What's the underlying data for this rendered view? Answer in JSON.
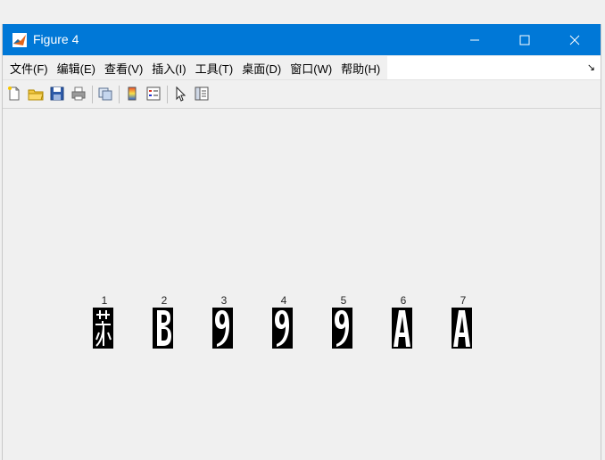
{
  "window": {
    "title": "Figure 4",
    "minimize_glyph": "—",
    "maximize_glyph": "☐",
    "close_glyph": "✕"
  },
  "menu": {
    "items": [
      {
        "label": "文件(F)"
      },
      {
        "label": "编辑(E)"
      },
      {
        "label": "查看(V)"
      },
      {
        "label": "插入(I)"
      },
      {
        "label": "工具(T)"
      },
      {
        "label": "桌面(D)"
      },
      {
        "label": "窗口(W)"
      },
      {
        "label": "帮助(H)"
      }
    ],
    "dock_glyph": "↘"
  },
  "toolbar": {
    "icons": [
      "new-figure-icon",
      "open-file-icon",
      "save-icon",
      "print-icon",
      "link-plot-icon",
      "colorbar-icon",
      "legend-icon",
      "pointer-icon",
      "property-inspector-icon"
    ]
  },
  "figure": {
    "subplots": [
      {
        "title": "1",
        "char": "苏"
      },
      {
        "title": "2",
        "char": "B"
      },
      {
        "title": "3",
        "char": "9"
      },
      {
        "title": "4",
        "char": "9"
      },
      {
        "title": "5",
        "char": "9"
      },
      {
        "title": "6",
        "char": "A"
      },
      {
        "title": "7",
        "char": "A"
      }
    ]
  },
  "colors": {
    "titlebar": "#0078d7",
    "background": "#f0f0f0",
    "image_bg": "#000000",
    "image_fg": "#ffffff"
  }
}
